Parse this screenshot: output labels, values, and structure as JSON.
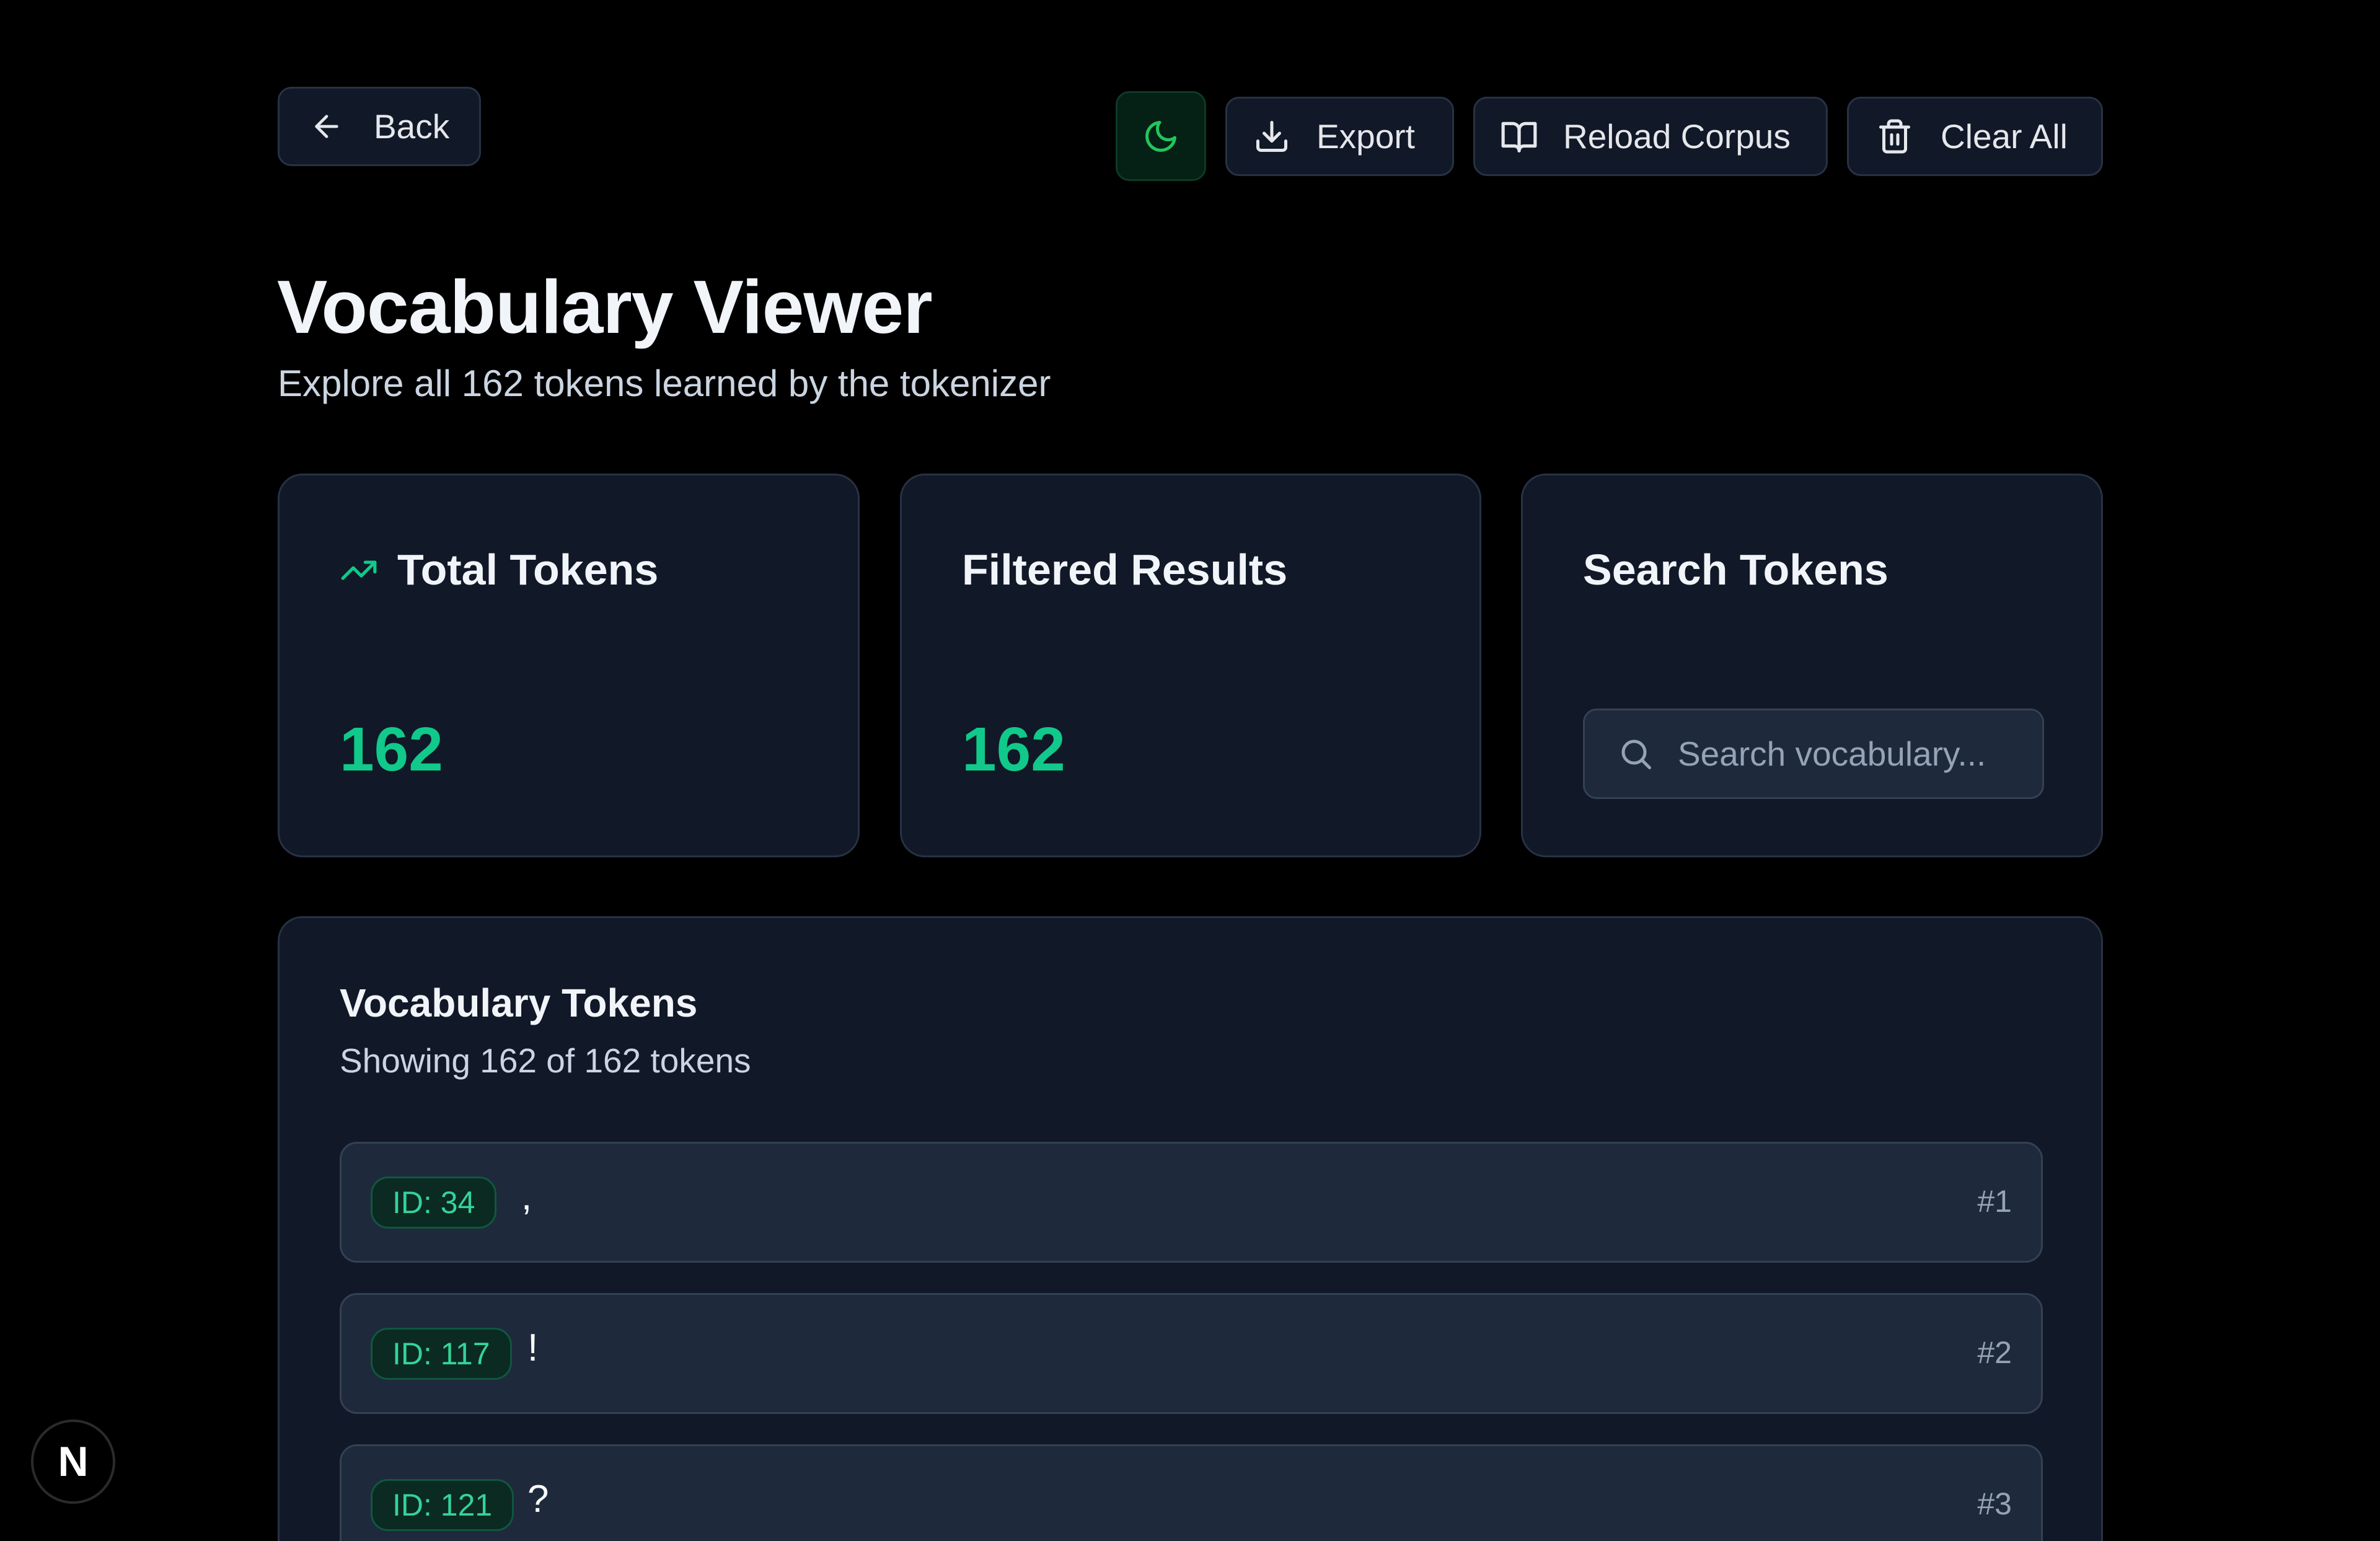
{
  "toolbar": {
    "back_label": "Back",
    "export_label": "Export",
    "reload_label": "Reload Corpus",
    "clear_label": "Clear All"
  },
  "header": {
    "title": "Vocabulary Viewer",
    "subtitle": "Explore all 162 tokens learned by the tokenizer"
  },
  "stats": {
    "total": {
      "label": "Total Tokens",
      "value": "162"
    },
    "filtered": {
      "label": "Filtered Results",
      "value": "162"
    },
    "search": {
      "label": "Search Tokens",
      "placeholder": "Search vocabulary...",
      "value": ""
    }
  },
  "vocab": {
    "title": "Vocabulary Tokens",
    "subtitle": "Showing 162 of 162 tokens",
    "tokens": [
      {
        "id": "ID: 34",
        "text": ",",
        "rank": "#1"
      },
      {
        "id": "ID: 117",
        "text": "!",
        "rank": "#2"
      },
      {
        "id": "ID: 121",
        "text": "?",
        "rank": "#3"
      }
    ]
  },
  "corner_badge": "N",
  "colors": {
    "accent": "#10c98a",
    "background": "#000000",
    "card": "#111827",
    "row": "#1e293b"
  },
  "icons": [
    "arrow-left-icon",
    "moon-icon",
    "download-icon",
    "book-open-icon",
    "trash-icon",
    "trending-up-icon",
    "search-icon"
  ]
}
